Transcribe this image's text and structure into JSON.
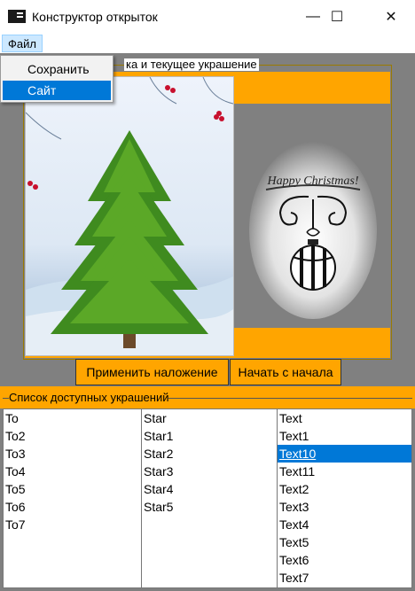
{
  "window": {
    "title": "Конструктор открыток",
    "minimize": "—",
    "maximize": "☐",
    "close": "✕"
  },
  "menu": {
    "file": "Файл",
    "items": [
      "Сохранить",
      "Сайт"
    ]
  },
  "groups": {
    "preview_legend": "ка и текущее украшение",
    "list_legend": "Список доступных украшений"
  },
  "ornament": {
    "text": "Happy Christmas!"
  },
  "buttons": {
    "apply": "Применить наложение",
    "restart": "Начать с начала"
  },
  "lists": {
    "col1": [
      "To",
      "To2",
      "To3",
      "To4",
      "To5",
      "To6",
      "To7"
    ],
    "col2": [
      "Star",
      "Star1",
      "Star2",
      "Star3",
      "Star4",
      "Star5"
    ],
    "col3": [
      "Text",
      "Text1",
      "Text10",
      "Text11",
      "Text2",
      "Text3",
      "Text4",
      "Text5",
      "Text6",
      "Text7"
    ],
    "col3_selected": "Text10"
  },
  "colors": {
    "accent": "#ffa500",
    "background": "#808080",
    "selection": "#0078d7"
  }
}
